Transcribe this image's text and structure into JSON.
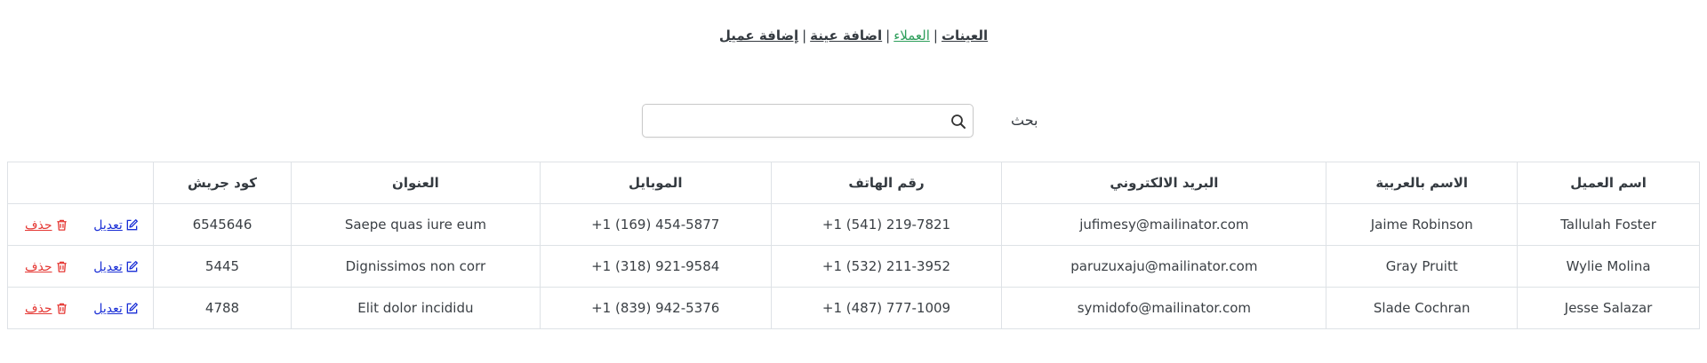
{
  "nav": {
    "items": [
      {
        "label": "العينات",
        "active": false
      },
      {
        "label": "العملاء",
        "active": true
      },
      {
        "label": "اضافة عينة",
        "active": false
      },
      {
        "label": "إضافة عميل",
        "active": false
      }
    ],
    "separator": "|"
  },
  "search": {
    "label": "بحث",
    "value": "",
    "placeholder": "",
    "icon": "search-icon"
  },
  "table": {
    "headers": {
      "name": "اسم العميل",
      "arabic_name": "الاسم بالعربية",
      "email": "البريد الالكتروني",
      "phone": "رقم الهاتف",
      "mobile": "الموبايل",
      "address": "العنوان",
      "code": "كود جريش",
      "actions": ""
    },
    "rows": [
      {
        "name": "Tallulah Foster",
        "arabic_name": "Jaime Robinson",
        "email": "jufimesy@mailinator.com",
        "phone": "+1 (541) 219-7821",
        "mobile": "+1 (169) 454-5877",
        "address": "Saepe quas iure eum",
        "code": "6545646",
        "edit": "تعديل",
        "delete": "حذف"
      },
      {
        "name": "Wylie Molina",
        "arabic_name": "Gray Pruitt",
        "email": "paruzuxaju@mailinator.com",
        "phone": "+1 (532) 211-3952",
        "mobile": "+1 (318) 921-9584",
        "address": "Dignissimos non corr",
        "code": "5445",
        "edit": "تعديل",
        "delete": "حذف"
      },
      {
        "name": "Jesse Salazar",
        "arabic_name": "Slade Cochran",
        "email": "symidofo@mailinator.com",
        "phone": "+1 (487) 777-1009",
        "mobile": "+1 (839) 942-5376",
        "address": "Elit dolor incididu",
        "code": "4788",
        "edit": "تعديل",
        "delete": "حذف"
      }
    ]
  },
  "colors": {
    "active_nav": "#2e9e5b",
    "edit_link": "#1a2fd6",
    "delete_link": "#e53935"
  }
}
